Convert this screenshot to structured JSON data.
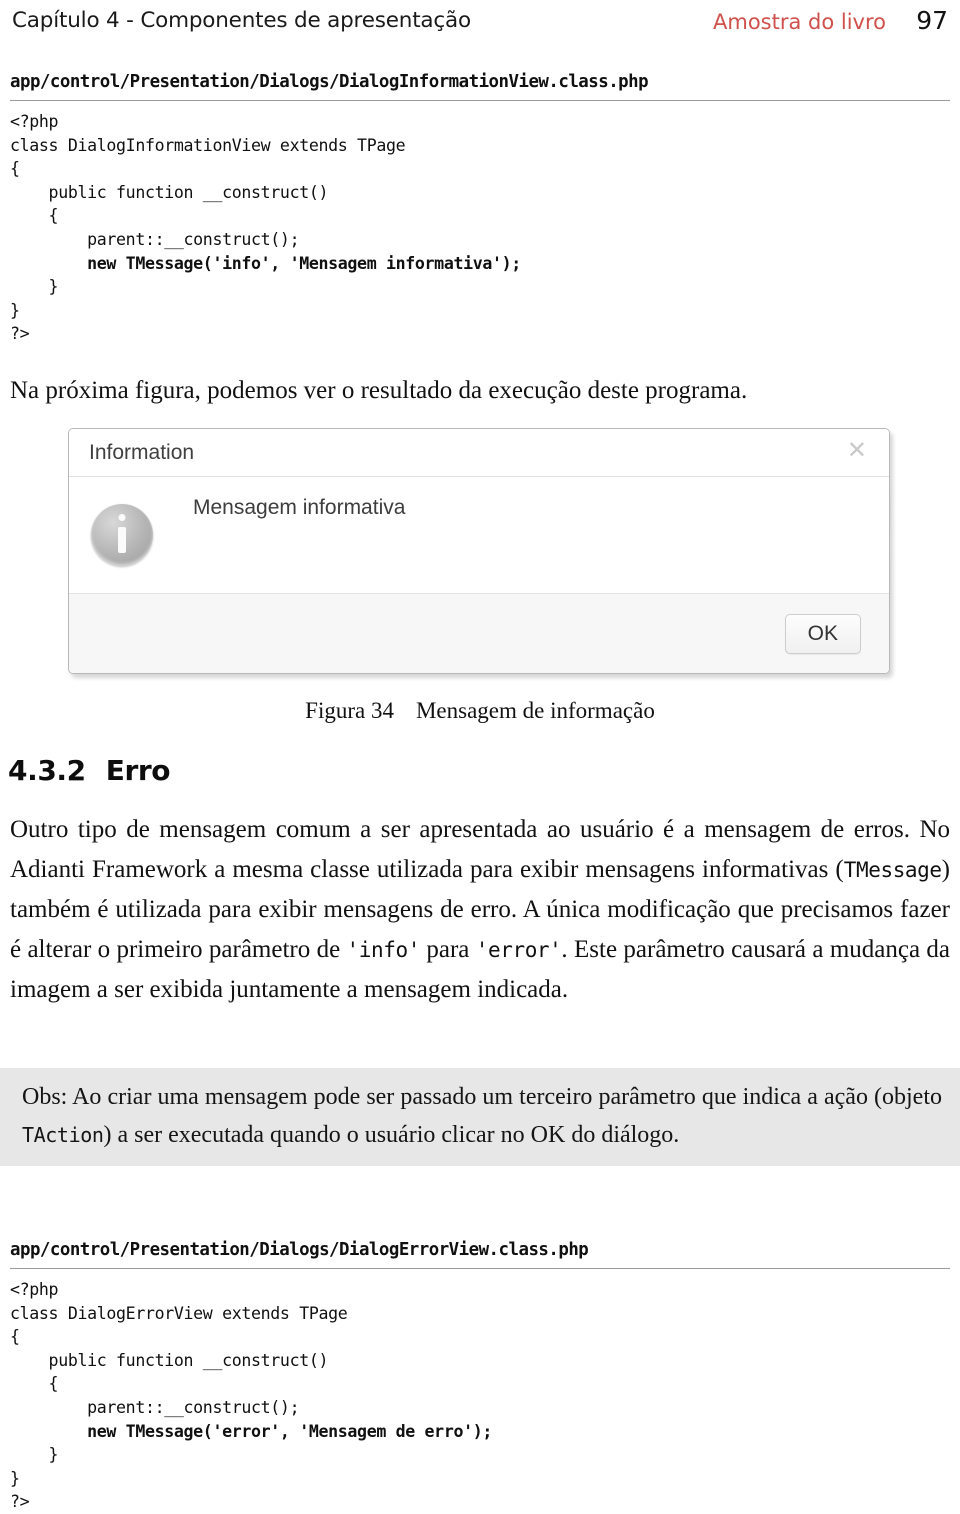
{
  "header": {
    "chapter_title": "Capítulo 4 - Componentes de apresentação",
    "sample_label": "Amostra do livro",
    "page_number": "97",
    "accent_color": "#d0504c"
  },
  "code_section_1": {
    "file_name": "app/control/Presentation/Dialogs/DialogInformationView.class.php",
    "code_plain_1": "<?php\nclass DialogInformationView extends TPage\n{\n    public function __construct()\n    {\n        parent::__construct();\n        ",
    "code_bold": "new TMessage('info', 'Mensagem informativa');",
    "code_plain_2": "\n    }\n}\n?>"
  },
  "intro_paragraph": "Na próxima figura, podemos ver o resultado da execução deste programa.",
  "figure": {
    "dialog": {
      "title": "Information",
      "close_label": "✕",
      "message": "Mensagem informativa",
      "ok_label": "OK",
      "icon_name": "info-icon"
    },
    "caption_label": "Figura 34",
    "caption_text": "Mensagem de informação"
  },
  "section": {
    "number": "4.3.2",
    "title": "Erro"
  },
  "body_paragraph": {
    "part1": "Outro tipo de mensagem comum a ser apresentada ao usuário é a mensagem de erros. No Adianti Framework a mesma classe utilizada para exibir mensagens informativas (",
    "code1": "TMessage",
    "part2": ") também é utilizada para exibir mensagens de erro. A única modificação que precisamos fazer é alterar o primeiro parâmetro de ",
    "code2": "'info'",
    "part3": " para ",
    "code3": "'error'",
    "part4": ". Este parâmetro causará a mudança da imagem a ser exibida juntamente a mensagem indicada."
  },
  "observation": {
    "part1": "Obs: Ao criar uma mensagem pode ser passado um terceiro parâmetro que indica a ação (objeto ",
    "code1": "TAction",
    "part2": ") a ser executada quando o usuário clicar no OK do diálogo.",
    "background_color": "#e7e7e7"
  },
  "code_section_2": {
    "file_name": "app/control/Presentation/Dialogs/DialogErrorView.class.php",
    "code_plain_1": "<?php\nclass DialogErrorView extends TPage\n{\n    public function __construct()\n    {\n        parent::__construct();\n        ",
    "code_bold": "new TMessage('error', 'Mensagem de erro');",
    "code_plain_2": "\n    }\n}\n?>"
  }
}
